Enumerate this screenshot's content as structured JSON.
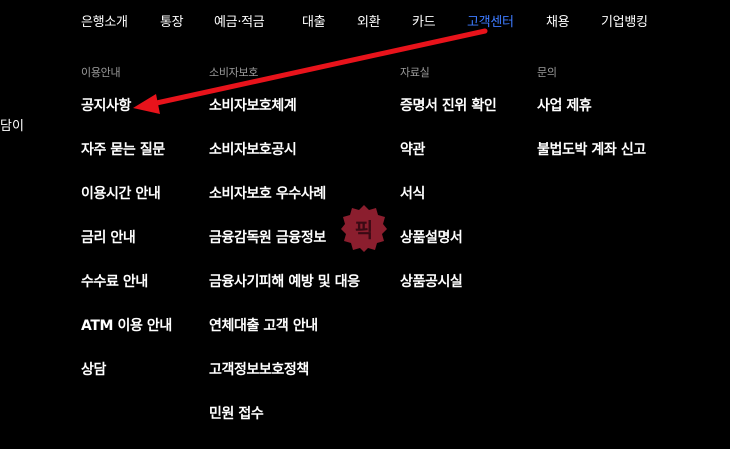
{
  "topnav": {
    "items": [
      "은행소개",
      "통장",
      "예금·적금",
      "대출",
      "외환",
      "카드",
      "고객센터",
      "채용",
      "기업뱅킹"
    ],
    "active": "고객센터",
    "active_color": "#3e7bff"
  },
  "side_text": "담이",
  "columns": [
    {
      "heading": "이용안내",
      "links": [
        "공지사항",
        "자주 묻는 질문",
        "이용시간 안내",
        "금리 안내",
        "수수료 안내",
        "ATM 이용 안내",
        "상담"
      ]
    },
    {
      "heading": "소비자보호",
      "links": [
        "소비자보호체계",
        "소비자보호공시",
        "소비자보호 우수사례",
        "금융감독원 금융정보",
        "금융사기피해 예방 및 대응",
        "연체대출 고객 안내",
        "고객정보보호정책",
        "민원 접수"
      ]
    },
    {
      "heading": "자료실",
      "links": [
        "증명서 진위 확인",
        "약관",
        "서식",
        "상품설명서",
        "상품공시실"
      ]
    },
    {
      "heading": "문의",
      "links": [
        "사업 제휴",
        "불법도박 계좌 신고"
      ]
    }
  ],
  "watermark": {
    "text": "픽",
    "color": "#8b1e2e"
  },
  "annotation": {
    "arrow_color": "#e8131b",
    "icon": "red-arrow-icon"
  }
}
